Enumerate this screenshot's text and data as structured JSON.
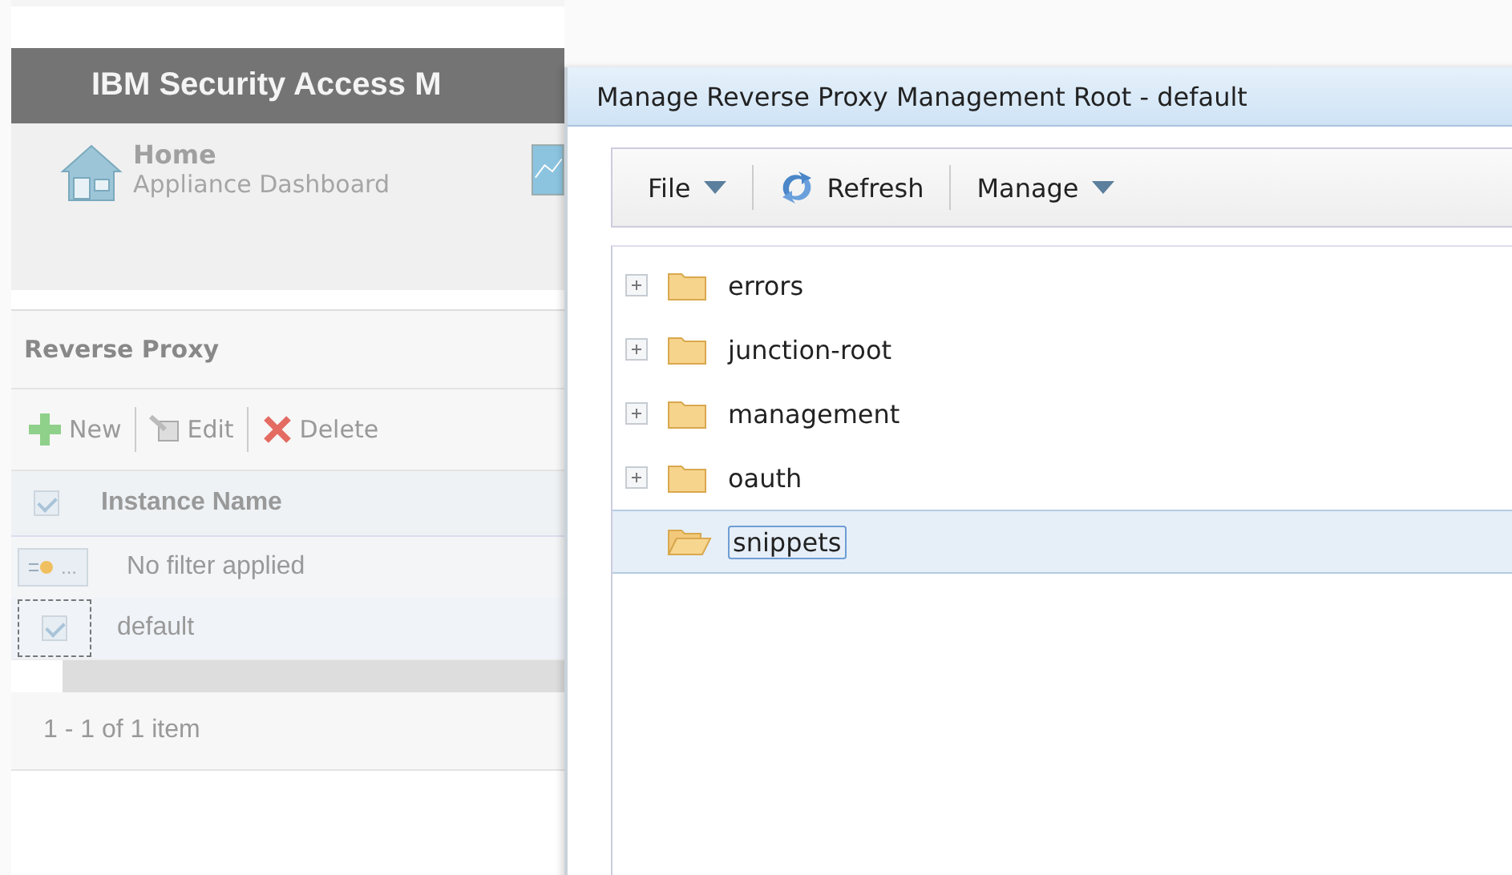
{
  "header": {
    "title": "IBM Security Access M"
  },
  "nav": {
    "title": "Home",
    "subtitle": "Appliance Dashboard"
  },
  "panel": {
    "title": "Reverse Proxy",
    "toolbar": [
      {
        "label": "New",
        "kind": "new"
      },
      {
        "label": "Edit",
        "kind": "edit"
      },
      {
        "label": "Delete",
        "kind": "delete"
      }
    ],
    "grid": {
      "header_checked": true,
      "columns": [
        "Instance Name"
      ],
      "filter": {
        "button": "...",
        "text": "No filter applied"
      },
      "rows": [
        {
          "name": "default",
          "checked": true
        }
      ],
      "footer": "1 - 1 of 1 item"
    }
  },
  "dialog": {
    "title": "Manage Reverse Proxy Management Root - default",
    "toolbar": [
      {
        "label": "File",
        "kind": "menu"
      },
      {
        "label": "Refresh",
        "kind": "refresh"
      },
      {
        "label": "Manage",
        "kind": "menu"
      }
    ],
    "tree": [
      {
        "label": "errors",
        "expandable": true,
        "selected": false
      },
      {
        "label": "junction-root",
        "expandable": true,
        "selected": false
      },
      {
        "label": "management",
        "expandable": true,
        "selected": false
      },
      {
        "label": "oauth",
        "expandable": true,
        "selected": false
      },
      {
        "label": "snippets",
        "expandable": false,
        "selected": true
      }
    ]
  }
}
